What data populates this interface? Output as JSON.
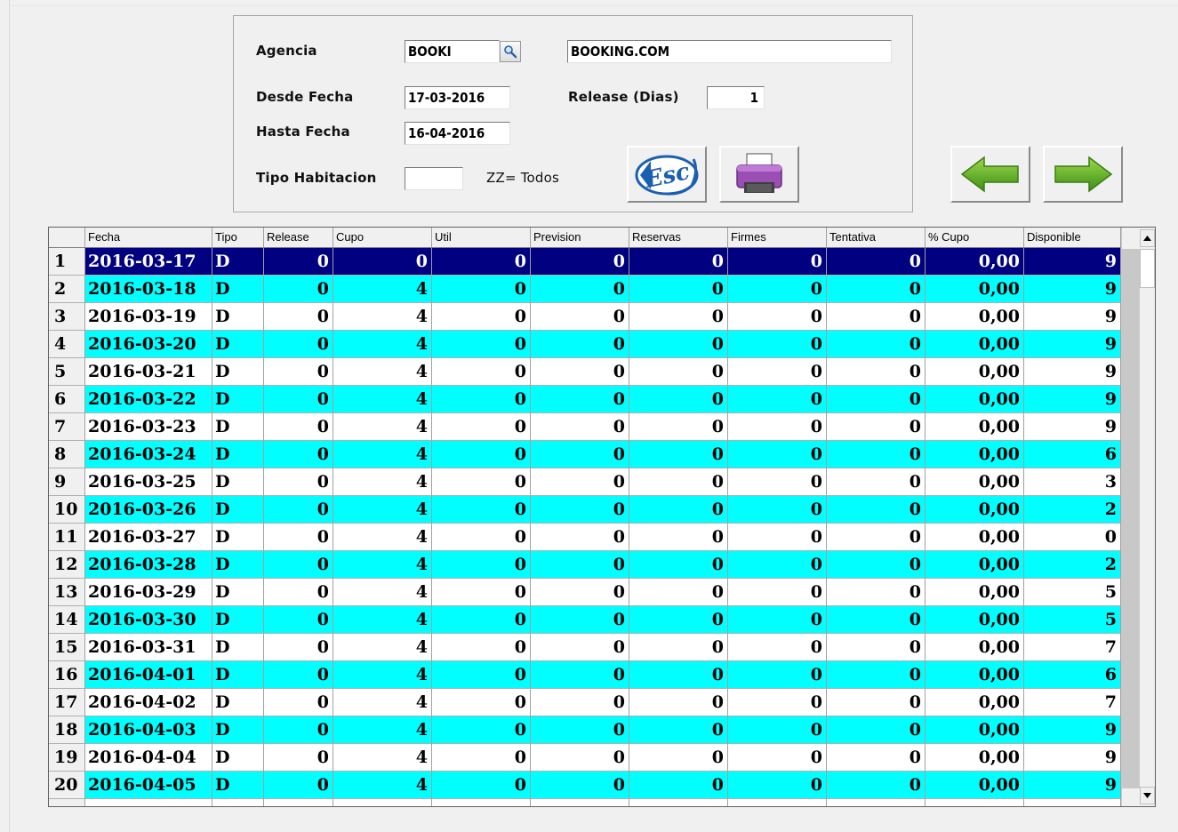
{
  "form": {
    "agencia_label": "Agencia",
    "agencia_code": "BOOKI",
    "agencia_name": "BOOKING.COM",
    "desde_label": "Desde Fecha",
    "desde_value": "17-03-2016",
    "hasta_label": "Hasta Fecha",
    "hasta_value": "16-04-2016",
    "release_label": "Release (Dias)",
    "release_value": "1",
    "tipo_label": "Tipo Habitacion",
    "tipo_value": "",
    "tipo_hint": "ZZ= Todos"
  },
  "buttons": {
    "esc_icon": "esc-logo-icon",
    "print_icon": "printer-icon",
    "prev_icon": "arrow-left-icon",
    "next_icon": "arrow-right-icon"
  },
  "colors": {
    "row_alt": "#00ffff",
    "selected": "#000080",
    "arrow_green": "#5fbb1f"
  },
  "grid": {
    "headers": [
      "Fecha",
      "Tipo",
      "Release",
      "Cupo",
      "Util",
      "Prevision",
      "Reservas",
      "Firmes",
      "Tentativa",
      "% Cupo",
      "Disponible"
    ],
    "rows": [
      {
        "n": "1",
        "fecha": "2016-03-17",
        "tipo": "D",
        "release": "0",
        "cupo": "0",
        "util": "0",
        "prevision": "0",
        "reservas": "0",
        "firmes": "0",
        "tentativa": "0",
        "pct": "0,00",
        "disp": "9"
      },
      {
        "n": "2",
        "fecha": "2016-03-18",
        "tipo": "D",
        "release": "0",
        "cupo": "4",
        "util": "0",
        "prevision": "0",
        "reservas": "0",
        "firmes": "0",
        "tentativa": "0",
        "pct": "0,00",
        "disp": "9"
      },
      {
        "n": "3",
        "fecha": "2016-03-19",
        "tipo": "D",
        "release": "0",
        "cupo": "4",
        "util": "0",
        "prevision": "0",
        "reservas": "0",
        "firmes": "0",
        "tentativa": "0",
        "pct": "0,00",
        "disp": "9"
      },
      {
        "n": "4",
        "fecha": "2016-03-20",
        "tipo": "D",
        "release": "0",
        "cupo": "4",
        "util": "0",
        "prevision": "0",
        "reservas": "0",
        "firmes": "0",
        "tentativa": "0",
        "pct": "0,00",
        "disp": "9"
      },
      {
        "n": "5",
        "fecha": "2016-03-21",
        "tipo": "D",
        "release": "0",
        "cupo": "4",
        "util": "0",
        "prevision": "0",
        "reservas": "0",
        "firmes": "0",
        "tentativa": "0",
        "pct": "0,00",
        "disp": "9"
      },
      {
        "n": "6",
        "fecha": "2016-03-22",
        "tipo": "D",
        "release": "0",
        "cupo": "4",
        "util": "0",
        "prevision": "0",
        "reservas": "0",
        "firmes": "0",
        "tentativa": "0",
        "pct": "0,00",
        "disp": "9"
      },
      {
        "n": "7",
        "fecha": "2016-03-23",
        "tipo": "D",
        "release": "0",
        "cupo": "4",
        "util": "0",
        "prevision": "0",
        "reservas": "0",
        "firmes": "0",
        "tentativa": "0",
        "pct": "0,00",
        "disp": "9"
      },
      {
        "n": "8",
        "fecha": "2016-03-24",
        "tipo": "D",
        "release": "0",
        "cupo": "4",
        "util": "0",
        "prevision": "0",
        "reservas": "0",
        "firmes": "0",
        "tentativa": "0",
        "pct": "0,00",
        "disp": "6"
      },
      {
        "n": "9",
        "fecha": "2016-03-25",
        "tipo": "D",
        "release": "0",
        "cupo": "4",
        "util": "0",
        "prevision": "0",
        "reservas": "0",
        "firmes": "0",
        "tentativa": "0",
        "pct": "0,00",
        "disp": "3"
      },
      {
        "n": "10",
        "fecha": "2016-03-26",
        "tipo": "D",
        "release": "0",
        "cupo": "4",
        "util": "0",
        "prevision": "0",
        "reservas": "0",
        "firmes": "0",
        "tentativa": "0",
        "pct": "0,00",
        "disp": "2"
      },
      {
        "n": "11",
        "fecha": "2016-03-27",
        "tipo": "D",
        "release": "0",
        "cupo": "4",
        "util": "0",
        "prevision": "0",
        "reservas": "0",
        "firmes": "0",
        "tentativa": "0",
        "pct": "0,00",
        "disp": "0"
      },
      {
        "n": "12",
        "fecha": "2016-03-28",
        "tipo": "D",
        "release": "0",
        "cupo": "4",
        "util": "0",
        "prevision": "0",
        "reservas": "0",
        "firmes": "0",
        "tentativa": "0",
        "pct": "0,00",
        "disp": "2"
      },
      {
        "n": "13",
        "fecha": "2016-03-29",
        "tipo": "D",
        "release": "0",
        "cupo": "4",
        "util": "0",
        "prevision": "0",
        "reservas": "0",
        "firmes": "0",
        "tentativa": "0",
        "pct": "0,00",
        "disp": "5"
      },
      {
        "n": "14",
        "fecha": "2016-03-30",
        "tipo": "D",
        "release": "0",
        "cupo": "4",
        "util": "0",
        "prevision": "0",
        "reservas": "0",
        "firmes": "0",
        "tentativa": "0",
        "pct": "0,00",
        "disp": "5"
      },
      {
        "n": "15",
        "fecha": "2016-03-31",
        "tipo": "D",
        "release": "0",
        "cupo": "4",
        "util": "0",
        "prevision": "0",
        "reservas": "0",
        "firmes": "0",
        "tentativa": "0",
        "pct": "0,00",
        "disp": "7"
      },
      {
        "n": "16",
        "fecha": "2016-04-01",
        "tipo": "D",
        "release": "0",
        "cupo": "4",
        "util": "0",
        "prevision": "0",
        "reservas": "0",
        "firmes": "0",
        "tentativa": "0",
        "pct": "0,00",
        "disp": "6"
      },
      {
        "n": "17",
        "fecha": "2016-04-02",
        "tipo": "D",
        "release": "0",
        "cupo": "4",
        "util": "0",
        "prevision": "0",
        "reservas": "0",
        "firmes": "0",
        "tentativa": "0",
        "pct": "0,00",
        "disp": "7"
      },
      {
        "n": "18",
        "fecha": "2016-04-03",
        "tipo": "D",
        "release": "0",
        "cupo": "4",
        "util": "0",
        "prevision": "0",
        "reservas": "0",
        "firmes": "0",
        "tentativa": "0",
        "pct": "0,00",
        "disp": "9"
      },
      {
        "n": "19",
        "fecha": "2016-04-04",
        "tipo": "D",
        "release": "0",
        "cupo": "4",
        "util": "0",
        "prevision": "0",
        "reservas": "0",
        "firmes": "0",
        "tentativa": "0",
        "pct": "0,00",
        "disp": "9"
      },
      {
        "n": "20",
        "fecha": "2016-04-05",
        "tipo": "D",
        "release": "0",
        "cupo": "4",
        "util": "0",
        "prevision": "0",
        "reservas": "0",
        "firmes": "0",
        "tentativa": "0",
        "pct": "0,00",
        "disp": "9"
      }
    ]
  }
}
